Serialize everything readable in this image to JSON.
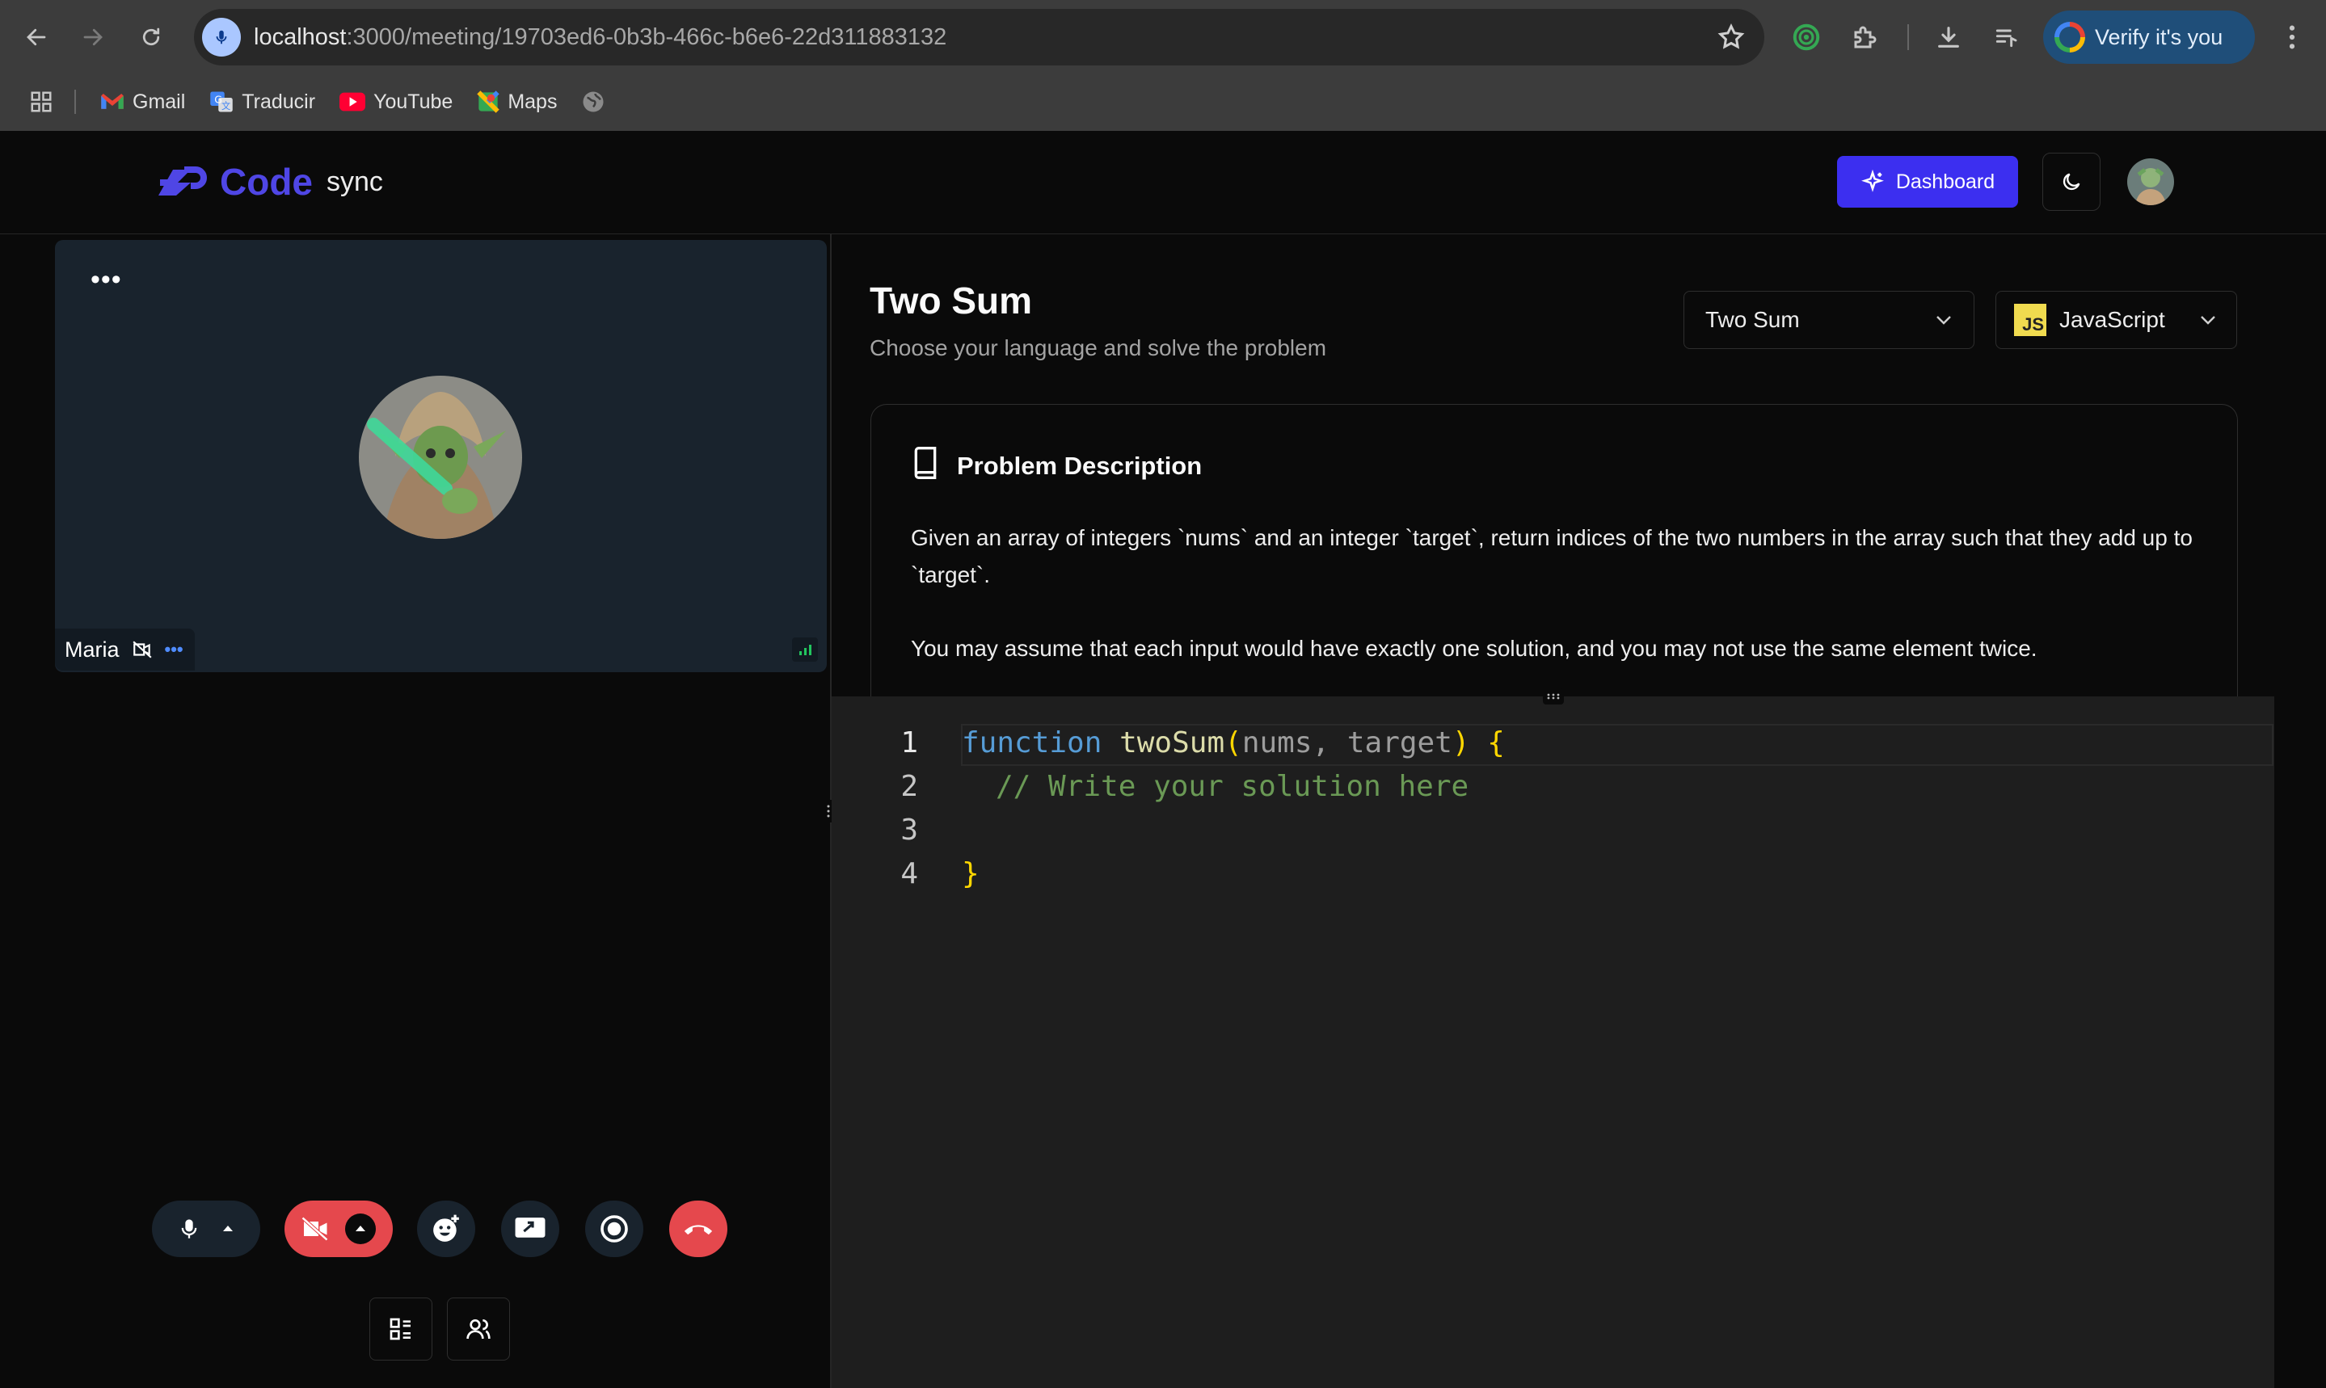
{
  "browser": {
    "url_host": "localhost",
    "url_path": ":3000/meeting/19703ed6-0b3b-466c-b6e6-22d311883132",
    "verify_label": "Verify it's you",
    "bookmarks": [
      "Gmail",
      "Traducir",
      "YouTube",
      "Maps"
    ]
  },
  "app": {
    "logo_text": "Code",
    "logo_sub": "sync",
    "dashboard_label": "Dashboard"
  },
  "meeting": {
    "participant_name": "Maria",
    "tile_menu": "•••",
    "name_menu": "•••"
  },
  "problem": {
    "title": "Two Sum",
    "subtitle": "Choose your language and solve the problem",
    "selected_problem": "Two Sum",
    "selected_language": "JavaScript",
    "js_badge": "JS",
    "description_heading": "Problem Description",
    "description_p1": "Given an array of integers `nums` and an integer `target`, return indices of the two numbers in the array such that they add up to `target`.",
    "description_p2": "You may assume that each input would have exactly one solution, and you may not use the same element twice."
  },
  "editor": {
    "line_numbers": [
      "1",
      "2",
      "3",
      "4"
    ],
    "line1": {
      "keyword": "function",
      "name": "twoSum",
      "open_paren": "(",
      "params": "nums, target",
      "close_paren": ")",
      "brace": "{"
    },
    "line2": "// Write your solution here",
    "line4": "}"
  },
  "colors": {
    "accent": "#3c2ff0",
    "logo": "#4f46e5",
    "end_call": "#e5484d",
    "camera_off": "#e5484d",
    "verify_bg": "#1f4e79"
  }
}
